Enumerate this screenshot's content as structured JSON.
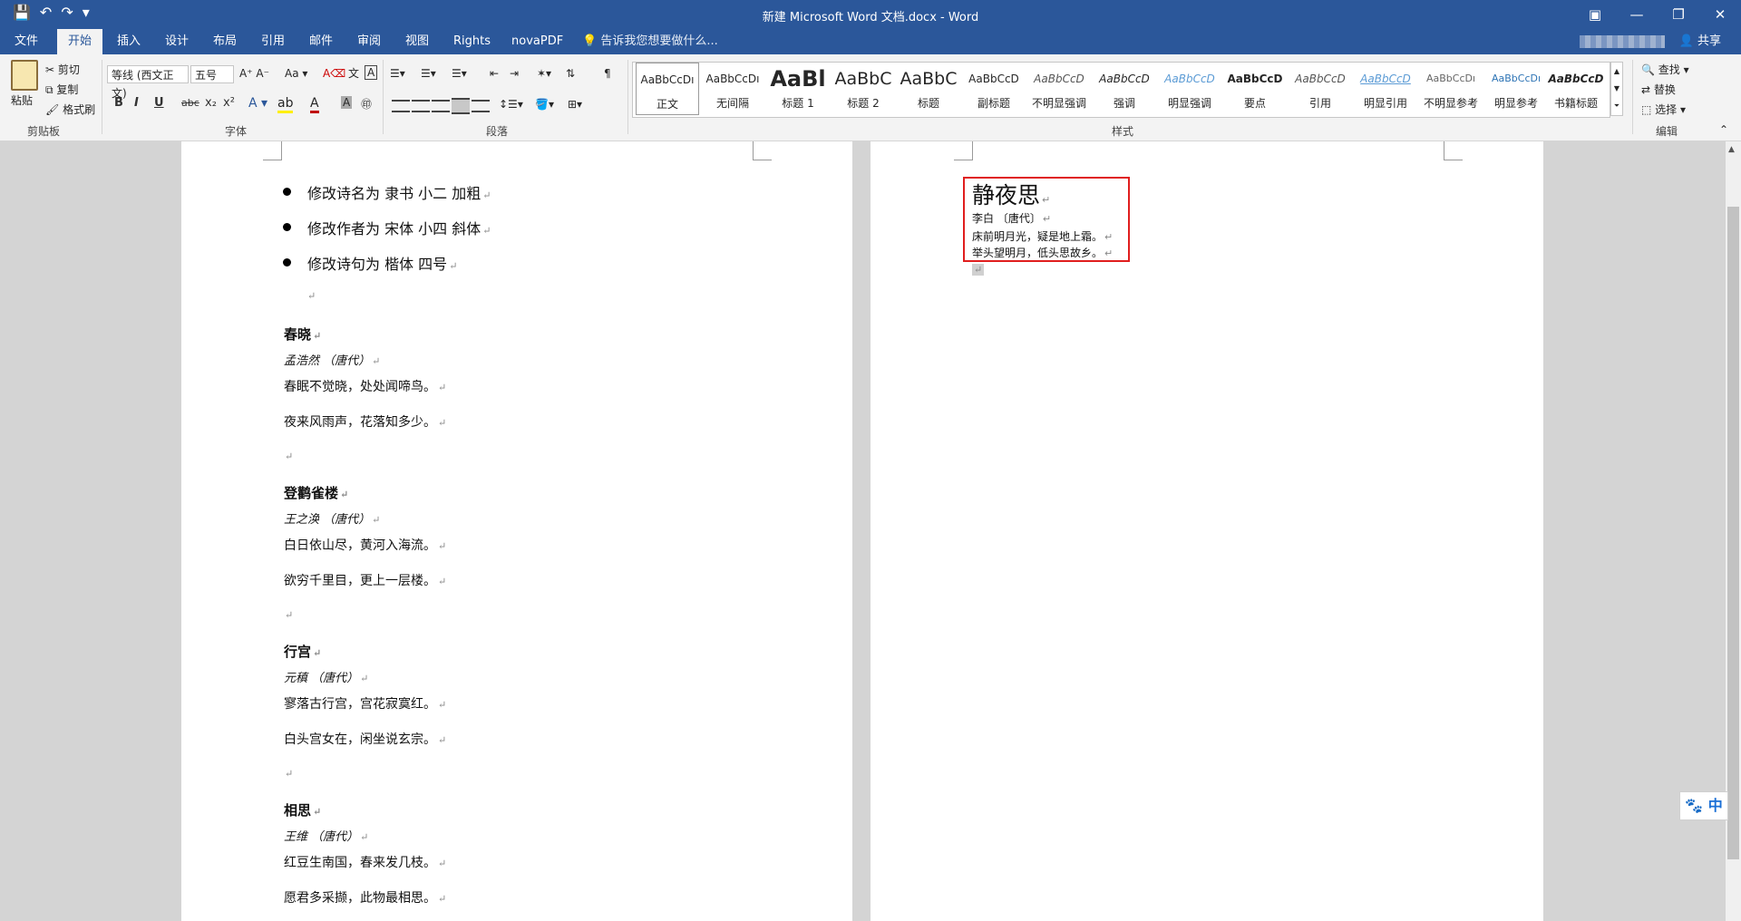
{
  "window": {
    "title": "新建 Microsoft Word 文档.docx - Word",
    "controls": [
      "▣",
      "—",
      "❐",
      "✕"
    ]
  },
  "quick_access": {
    "save": "💾",
    "undo": "↶",
    "redo": "↷",
    "more": "▾"
  },
  "tabs": [
    "文件",
    "开始",
    "插入",
    "设计",
    "布局",
    "引用",
    "邮件",
    "审阅",
    "视图",
    "Rights",
    "novaPDF"
  ],
  "active_tab": "开始",
  "tell_me": "告诉我您想要做什么...",
  "share_label": "共享",
  "clipboard": {
    "paste": "粘贴",
    "cut": "剪切",
    "copy": "复制",
    "format_painter": "格式刷",
    "group": "剪贴板"
  },
  "font": {
    "family": "等线 (西文正文)",
    "size": "五号",
    "group": "字体",
    "buttons": [
      "B",
      "I",
      "U",
      "abc",
      "x₂",
      "x²"
    ]
  },
  "paragraph": {
    "group": "段落"
  },
  "styles": {
    "group": "样式",
    "items": [
      {
        "preview": "AaBbCcDı",
        "name": "正文"
      },
      {
        "preview": "AaBbCcDı",
        "name": "无间隔"
      },
      {
        "preview": "AaBl",
        "name": "标题 1"
      },
      {
        "preview": "AaBbC",
        "name": "标题 2"
      },
      {
        "preview": "AaBbC",
        "name": "标题"
      },
      {
        "preview": "AaBbCcD",
        "name": "副标题"
      },
      {
        "preview": "AaBbCcD",
        "name": "不明显强调"
      },
      {
        "preview": "AaBbCcD",
        "name": "强调"
      },
      {
        "preview": "AaBbCcD",
        "name": "明显强调"
      },
      {
        "preview": "AaBbCcD",
        "name": "要点"
      },
      {
        "preview": "AaBbCcD",
        "name": "引用"
      },
      {
        "preview": "AaBbCcD",
        "name": "明显引用"
      },
      {
        "preview": "AaBbCcDı",
        "name": "不明显参考"
      },
      {
        "preview": "AaBbCcDı",
        "name": "明显参考"
      },
      {
        "preview": "AaBbCcD",
        "name": "书籍标题"
      }
    ]
  },
  "editing": {
    "find": "查找",
    "replace": "替换",
    "select": "选择",
    "group": "编辑"
  },
  "page1": {
    "bullets": [
      "修改诗名为 隶书 小二 加粗",
      "修改作者为 宋体 小四 斜体",
      "修改诗句为 楷体 四号"
    ],
    "poems": [
      {
        "title": "春晓",
        "author": "孟浩然 （唐代）",
        "lines": [
          "春眠不觉晓，处处闻啼鸟。",
          "夜来风雨声，花落知多少。"
        ]
      },
      {
        "title": "登鹳雀楼",
        "author": "王之涣 （唐代）",
        "lines": [
          "白日依山尽，黄河入海流。",
          "欲穷千里目，更上一层楼。"
        ]
      },
      {
        "title": "行宫",
        "author": "元稹 （唐代）",
        "lines": [
          "寥落古行宫，宫花寂寞红。",
          "白头宫女在，闲坐说玄宗。"
        ]
      },
      {
        "title": "相思",
        "author": "王维 （唐代）",
        "lines": [
          "红豆生南国，春来发几枝。",
          "愿君多采撷，此物最相思。"
        ]
      }
    ]
  },
  "page2": {
    "title": "静夜思",
    "author": "李白 〔唐代〕",
    "lines": [
      "床前明月光，疑是地上霜。",
      "举头望明月，低头思故乡。"
    ]
  },
  "ime": "中",
  "colors": {
    "accent": "#2b579a",
    "highlight_box": "#e01e1e"
  }
}
